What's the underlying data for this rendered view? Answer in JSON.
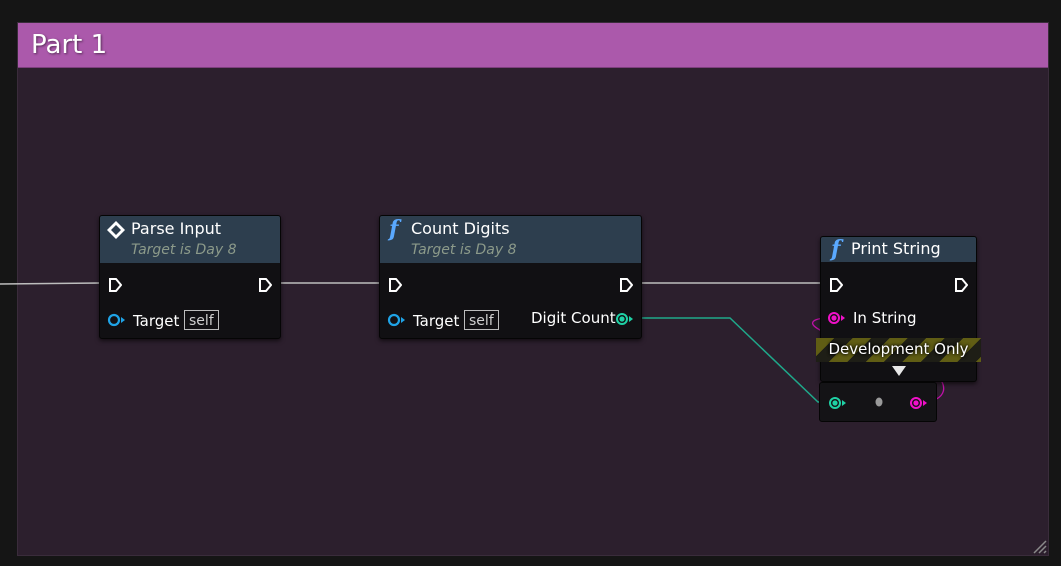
{
  "comment": {
    "title": "Part 1"
  },
  "nodes": {
    "parse_input": {
      "title": "Parse Input",
      "subtitle": "Target is Day 8",
      "target_label": "Target",
      "target_default": "self"
    },
    "count_digits": {
      "title": "Count Digits",
      "subtitle": "Target is Day 8",
      "target_label": "Target",
      "target_default": "self",
      "output_label": "Digit Count"
    },
    "print_string": {
      "title": "Print String",
      "input_label": "In String",
      "banner": "Development Only"
    }
  },
  "colors": {
    "comment_header": "#ab59ab",
    "comment_body": "#2c1f2d",
    "node_header": "#2d3e4e",
    "exec_pin": "#ffffff",
    "object_pin": "#1fa3e6",
    "integer_pin": "#1fd1a5",
    "string_pin": "#f010c8",
    "wire_exec": "#bdbdbd",
    "wire_int": "#1fa88a"
  },
  "icons": {
    "event_node": "diamond-icon",
    "function_node": "function-f-icon",
    "exec": "exec-arrow-icon"
  }
}
